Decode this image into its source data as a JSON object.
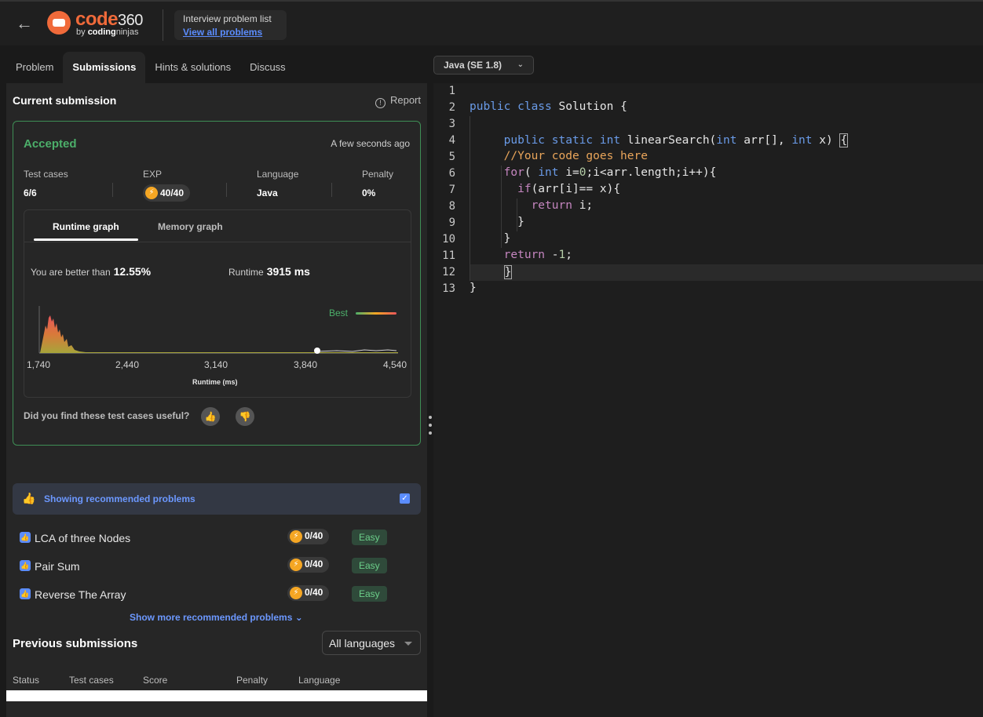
{
  "header": {
    "brand_main": "code",
    "brand_num": "360",
    "brand_by": "by",
    "brand_sub_a": "coding",
    "brand_sub_b": "ninjas",
    "breadcrumb_title": "Interview problem list",
    "breadcrumb_link": "View all problems"
  },
  "tabs": [
    "Problem",
    "Submissions",
    "Hints & solutions",
    "Discuss"
  ],
  "current": {
    "title": "Current submission",
    "report": "Report",
    "status": "Accepted",
    "time": "A few seconds ago",
    "stats": [
      {
        "label": "Test cases",
        "value": "6/6"
      },
      {
        "label": "EXP",
        "value": "40/40"
      },
      {
        "label": "Language",
        "value": "Java"
      },
      {
        "label": "Penalty",
        "value": "0%"
      }
    ],
    "graph_tabs": [
      "Runtime graph",
      "Memory graph"
    ],
    "better_label": "You are better than",
    "better_value": "12.55%",
    "runtime_label": "Runtime",
    "runtime_value": "3915 ms",
    "best_label": "Best",
    "x_ticks": [
      "1,740",
      "2,440",
      "3,140",
      "3,840",
      "4,540"
    ],
    "x_label": "Runtime (ms)",
    "useful_q": "Did you find these test cases useful?"
  },
  "recommended": {
    "banner": "Showing recommended problems",
    "items": [
      {
        "name": "LCA of three Nodes",
        "exp": "0/40",
        "level": "Easy"
      },
      {
        "name": "Pair Sum",
        "exp": "0/40",
        "level": "Easy"
      },
      {
        "name": "Reverse The Array",
        "exp": "0/40",
        "level": "Easy"
      }
    ],
    "show_more": "Show more recommended problems"
  },
  "previous": {
    "title": "Previous submissions",
    "filter": "All languages",
    "columns": [
      "Status",
      "Test cases",
      "Score",
      "Penalty",
      "Language"
    ]
  },
  "editor": {
    "language": "Java (SE 1.8)",
    "line_numbers": [
      "1",
      "2",
      "3",
      "4",
      "5",
      "6",
      "7",
      "8",
      "9",
      "10",
      "11",
      "12",
      "13"
    ]
  }
}
